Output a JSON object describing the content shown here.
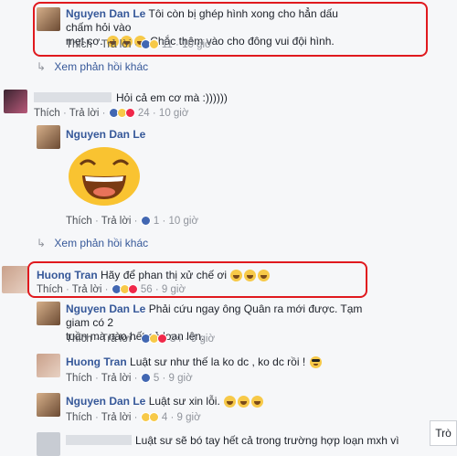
{
  "comments": [
    {
      "name": "Nguyen Dan Le",
      "text1": "Tôi còn bị ghép hình xong cho hẳn dấu chấm hỏi vào",
      "text2": "mẹt cơ.",
      "text3": "Chắc thêm vào cho đông vui đội hình.",
      "like": "Thích",
      "reply": "Trả lời",
      "count": "11",
      "time": "10 giờ"
    },
    {
      "name": "",
      "text": "Hỏi cả em cơ mà :))))))",
      "like": "Thích",
      "reply": "Trả lời",
      "count": "24",
      "time": "10 giờ"
    },
    {
      "name": "Nguyen Dan Le",
      "like": "Thích",
      "reply": "Trả lời",
      "count": "1",
      "time": "10 giờ"
    },
    {
      "name": "Huong Tran",
      "text": "Hãy để phan thị xử chế ơi",
      "like": "Thích",
      "reply": "Trả lời",
      "count": "56",
      "time": "9 giờ"
    },
    {
      "name": "Nguyen Dan Le",
      "text1": "Phải cứu ngay ông Quân ra mới được. Tạm giam có 2",
      "text2": "tuần mà nào hết cả loạn lên.",
      "like": "Thích",
      "reply": "Trả lời",
      "count": "34",
      "time": "9 giờ"
    },
    {
      "name": "Huong Tran",
      "text": "Luật sư như thế la ko dc , ko dc rồi !",
      "like": "Thích",
      "reply": "Trả lời",
      "count": "5",
      "time": "9 giờ"
    },
    {
      "name": "Nguyen Dan Le",
      "text": "Luật sư xin lỗi.",
      "like": "Thích",
      "reply": "Trả lời",
      "count": "4",
      "time": "9 giờ"
    },
    {
      "name": "",
      "text": "Luật sư sẽ bó tay hết cả trong trường hợp loạn mxh vì",
      "like": "Thích",
      "reply": "Trả lời",
      "count": "",
      "time": ""
    }
  ],
  "more_replies": "Xem phản hồi khác",
  "corner_button": "Trò",
  "colors": {
    "accent": "#365899",
    "highlight": "#e0191e"
  },
  "icons": [
    "reply-arrow-icon",
    "like-reaction-icon",
    "haha-reaction-icon",
    "love-reaction-icon",
    "laugh-emoji-icon",
    "sunglasses-emoji-icon"
  ]
}
